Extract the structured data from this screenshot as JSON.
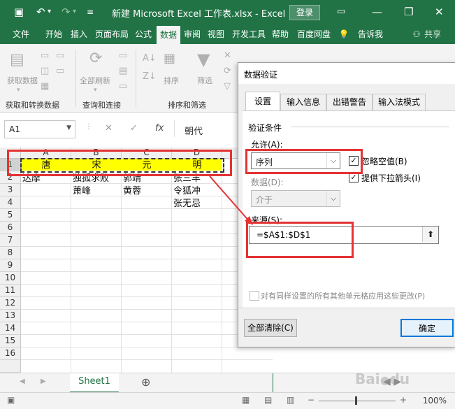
{
  "window": {
    "title": "新建 Microsoft Excel 工作表.xlsx  -  Excel",
    "login_label": "登录"
  },
  "ribbon_tabs": [
    "文件",
    "开始",
    "插入",
    "页面布局",
    "公式",
    "数据",
    "审阅",
    "视图",
    "开发工具",
    "帮助",
    "百度网盘",
    "告诉我",
    "共享"
  ],
  "ribbon": {
    "get_data_label": "获取数据",
    "refresh_all_label": "全部刷新",
    "sort_label": "排序",
    "filter_label": "筛选",
    "group_get_transform": "获取和转换数据",
    "group_queries": "查询和连接",
    "group_sort_filter": "排序和筛选"
  },
  "formula_bar": {
    "name_box": "A1",
    "fx_label": "fx",
    "value": "朝代"
  },
  "grid": {
    "columns": [
      "A",
      "B",
      "C",
      "D"
    ],
    "rows": [
      "1",
      "2",
      "3",
      "4",
      "5",
      "6",
      "7",
      "8",
      "9",
      "10",
      "11",
      "12",
      "13",
      "14",
      "15",
      "16"
    ],
    "row1": [
      "唐",
      "宋",
      "元",
      "明"
    ],
    "cells": {
      "A2": "达摩",
      "B2": "独孤求败",
      "B3": "萧峰",
      "C2": "郭靖",
      "C3": "黄蓉",
      "D2": "张三丰",
      "D3": "令狐冲",
      "D4": "张无忌"
    }
  },
  "sheets": {
    "active": "Sheet1",
    "add_label": "⊕"
  },
  "status": {
    "zoom": "100%"
  },
  "dialog": {
    "title": "数据验证",
    "tabs": [
      "设置",
      "输入信息",
      "出错警告",
      "输入法模式"
    ],
    "active_tab": "设置",
    "section_label": "验证条件",
    "allow_label": "允许(A):",
    "allow_value": "序列",
    "ignore_blank_label": "忽略空值(B)",
    "ignore_blank_checked": true,
    "dropdown_label": "提供下拉箭头(I)",
    "dropdown_checked": true,
    "data_label": "数据(D):",
    "data_value": "介于",
    "source_label": "来源(S):",
    "source_value": "=$A$1:$D$1",
    "apply_all_label": "对有同样设置的所有其他单元格应用这些更改(P)",
    "clear_all_label": "全部清除(C)",
    "ok_label": "确定"
  },
  "colors": {
    "excel_green": "#217346",
    "highlight_yellow": "#ffff00",
    "annotation_red": "#e53333"
  }
}
